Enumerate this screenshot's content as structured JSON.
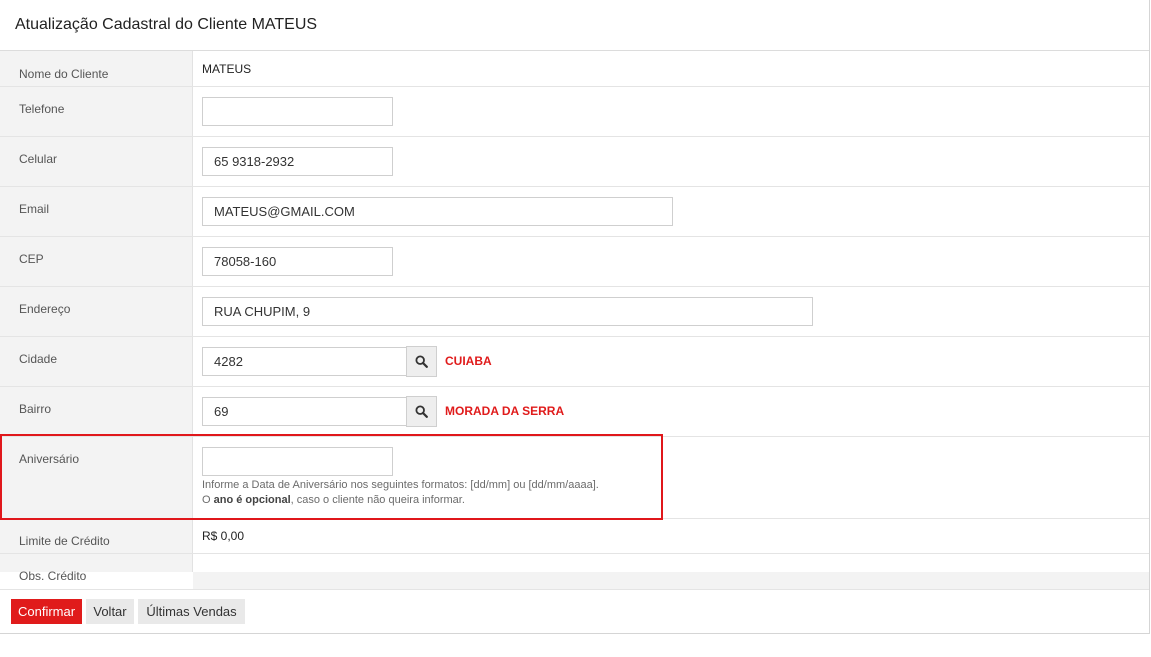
{
  "page": {
    "title": "Atualização Cadastral do Cliente MATEUS"
  },
  "fields": {
    "nome": {
      "label": "Nome do Cliente",
      "value": "MATEUS"
    },
    "telefone": {
      "label": "Telefone",
      "value": ""
    },
    "celular": {
      "label": "Celular",
      "value": "65 9318-2932"
    },
    "email": {
      "label": "Email",
      "value": "MATEUS@GMAIL.COM"
    },
    "cep": {
      "label": "CEP",
      "value": "78058-160"
    },
    "endereco": {
      "label": "Endereço",
      "value": "RUA CHUPIM, 9"
    },
    "cidade": {
      "label": "Cidade",
      "value": "4282",
      "name": "CUIABA"
    },
    "bairro": {
      "label": "Bairro",
      "value": "69",
      "name": "MORADA DA SERRA"
    },
    "aniversario": {
      "label": "Aniversário",
      "value": "",
      "help_line1": "Informe a Data de Aniversário nos seguintes formatos: [dd/mm] ou [dd/mm/aaaa].",
      "help_prefix": "O ",
      "help_bold": "ano é opcional",
      "help_suffix": ", caso o cliente não queira informar."
    },
    "limite": {
      "label": "Limite de Crédito",
      "value": "R$ 0,00"
    },
    "obs": {
      "label": "Obs. Crédito"
    }
  },
  "buttons": {
    "confirm": "Confirmar",
    "back": "Voltar",
    "sales": "Últimas Vendas"
  },
  "colors": {
    "accent": "#e01b1b",
    "highlight_border": "#e0171b"
  },
  "icons": {
    "search": "search-icon"
  }
}
